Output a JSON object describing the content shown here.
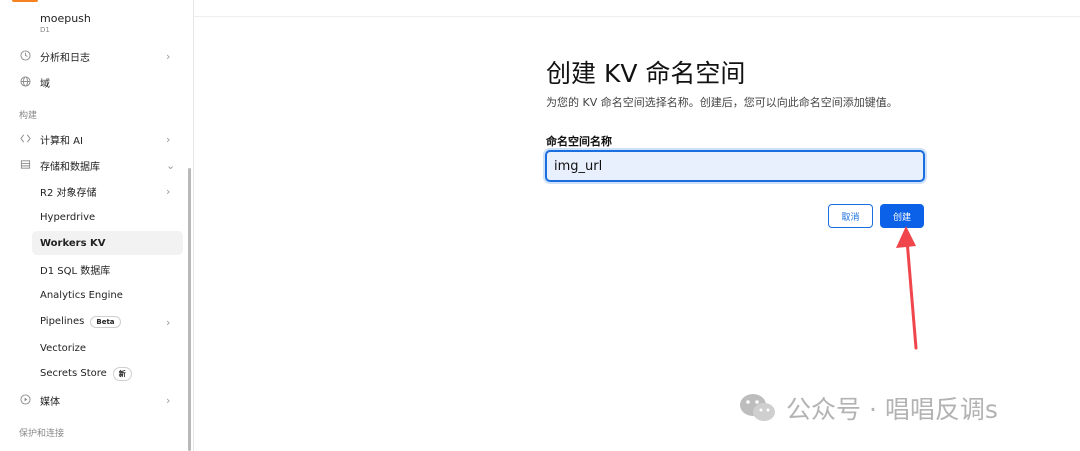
{
  "sidebar": {
    "account": {
      "name": "moepush",
      "sub": "D1"
    },
    "top_items": [
      {
        "label": "分析和日志",
        "icon": "clock-icon",
        "chevron": "›"
      },
      {
        "label": "域",
        "icon": "globe-icon"
      }
    ],
    "section_build": "构建",
    "build_items": [
      {
        "label": "计算和 AI",
        "icon": "compute-icon",
        "chevron": "›"
      },
      {
        "label": "存储和数据库",
        "icon": "database-icon",
        "chevron": "⌄"
      }
    ],
    "storage_items": [
      {
        "label": "R2 对象存储",
        "chevron": "›"
      },
      {
        "label": "Hyperdrive"
      },
      {
        "label": "Workers KV",
        "active": true
      },
      {
        "label": "D1 SQL 数据库"
      },
      {
        "label": "Analytics Engine"
      },
      {
        "label": "Pipelines",
        "badge": "Beta",
        "chevron": "›"
      },
      {
        "label": "Vectorize"
      },
      {
        "label": "Secrets Store",
        "badge": "新"
      }
    ],
    "media_item": {
      "label": "媒体",
      "icon": "play-icon",
      "chevron": "›"
    },
    "section_protect": "保护和连接"
  },
  "form": {
    "title": "创建 KV 命名空间",
    "subtitle": "为您的 KV 命名空间选择名称。创建后，您可以向此命名空间添加键值。",
    "field_label": "命名空间名称",
    "field_value": "img_url",
    "cancel_label": "取消",
    "create_label": "创建"
  },
  "annotation": {
    "arrow_color": "#f0464b"
  },
  "watermark": {
    "text": "公众号 · 唱唱反调s"
  },
  "colors": {
    "accent": "#0b62e8",
    "input_bg": "#e9f0fd"
  }
}
